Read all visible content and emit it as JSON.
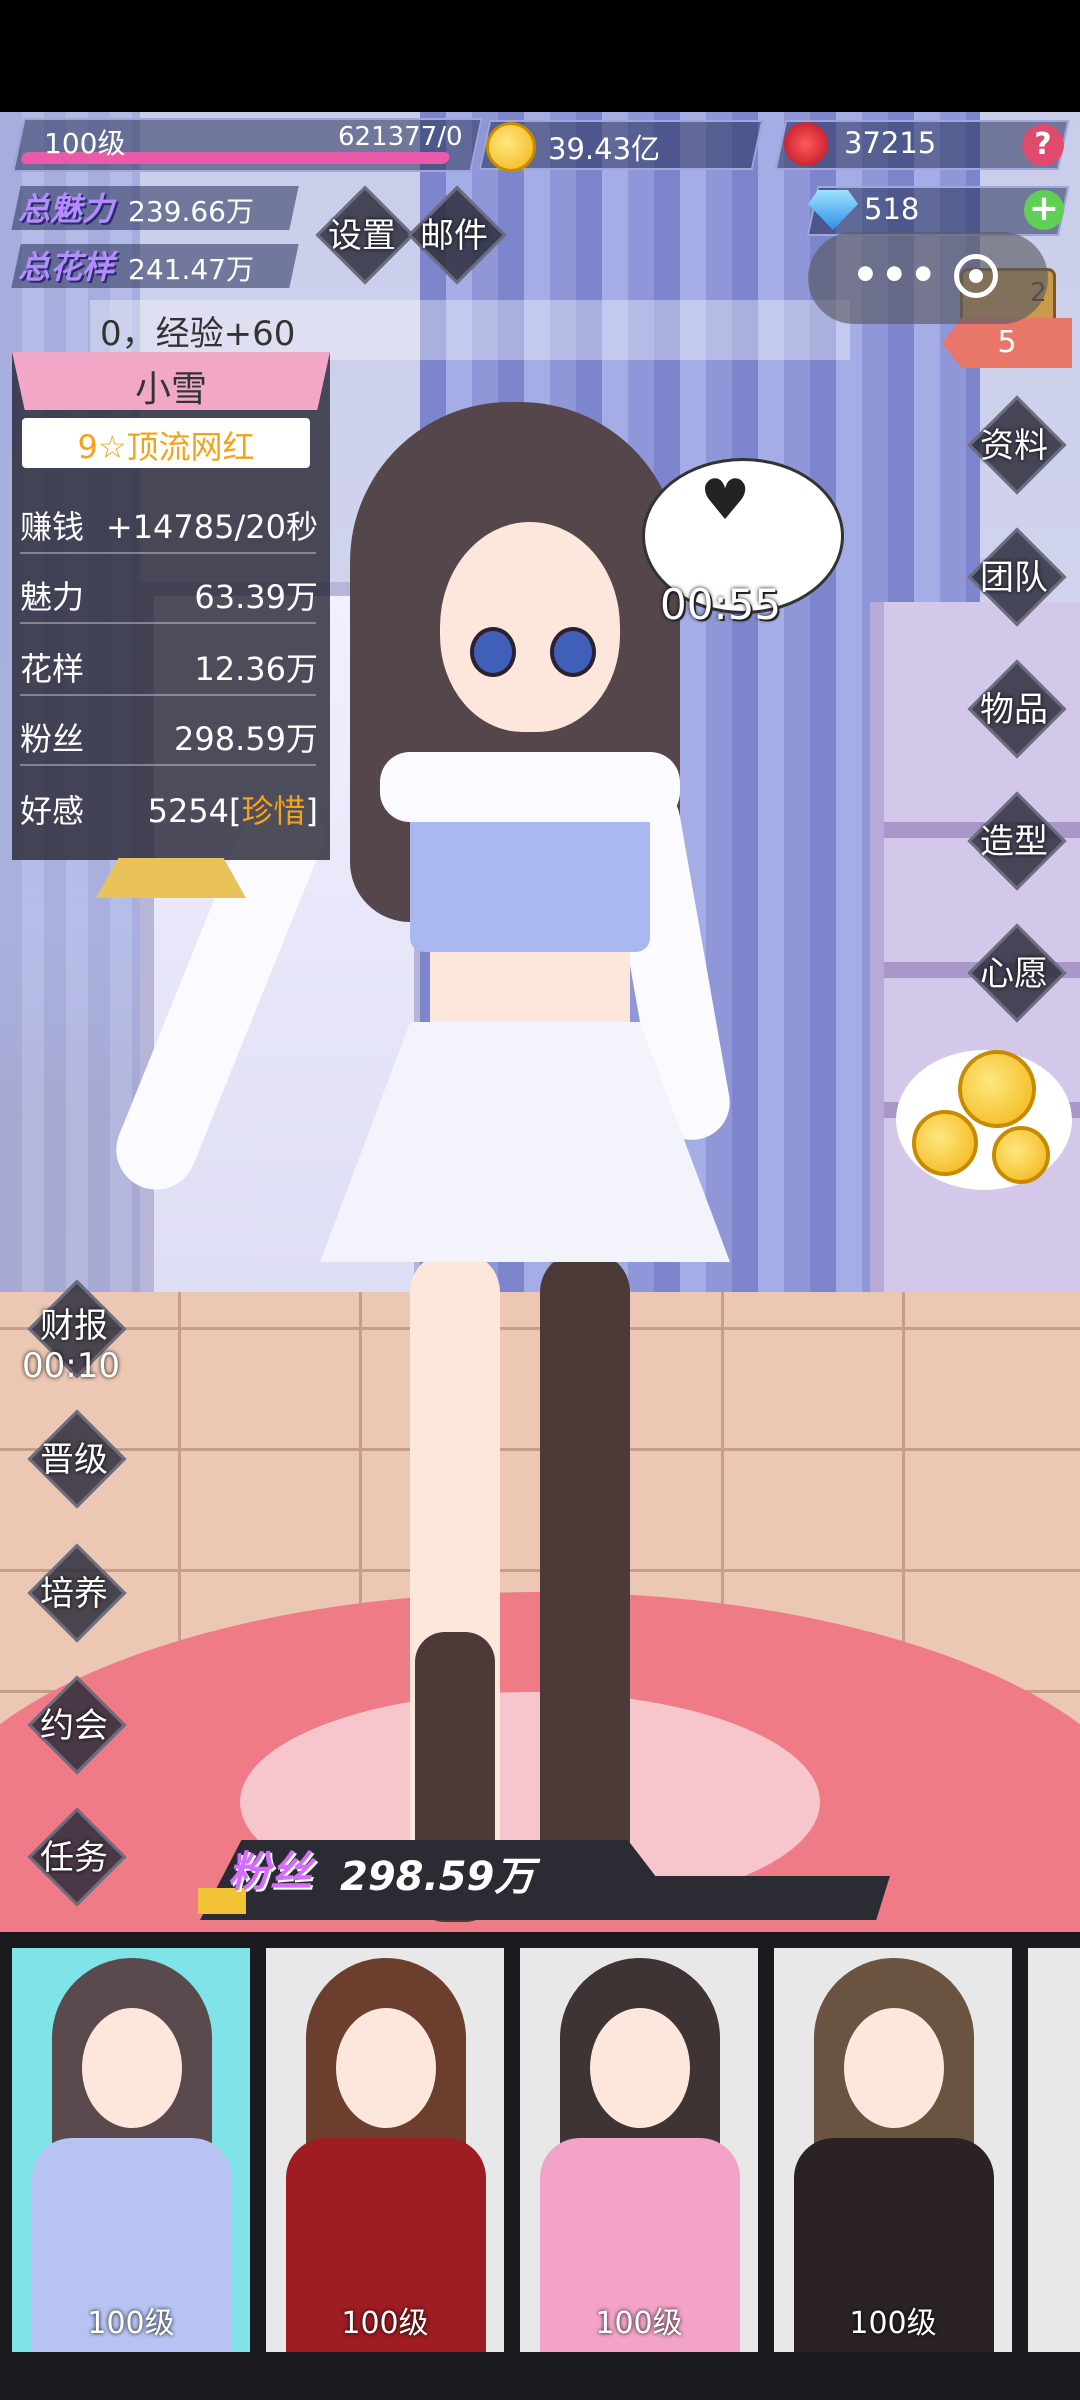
{
  "header": {
    "level": "100级",
    "exp": "621377/0",
    "exp_progress": 0.94,
    "gold": "39.43亿",
    "roses": "37215",
    "diamonds": "518",
    "help_symbol": "?",
    "add_symbol": "+"
  },
  "stats": {
    "charm_label": "总魅力",
    "charm_value": "239.66万",
    "style_label": "总花样",
    "style_value": "241.47万"
  },
  "top_buttons": {
    "settings": "设置",
    "mail": "邮件"
  },
  "marquee": "0，经验+60",
  "reward_count": "5",
  "chest_count": "2",
  "character": {
    "name": "小雪",
    "title": "9☆顶流网红",
    "rows": [
      {
        "label": "赚钱",
        "value": "+14785/20秒"
      },
      {
        "label": "魅力",
        "value": "63.39万"
      },
      {
        "label": "花样",
        "value": "12.36万"
      },
      {
        "label": "粉丝",
        "value": "298.59万"
      }
    ],
    "favor_label": "好感",
    "favor_value": "5254",
    "favor_bracket_open": "[",
    "favor_status": "珍惜",
    "favor_bracket_close": "]"
  },
  "bubble_timer": "00:55",
  "right_menu": [
    "资料",
    "团队",
    "物品",
    "造型",
    "心愿"
  ],
  "left_menu": {
    "report": "财报",
    "report_timer": "00:10",
    "items": [
      "晋级",
      "培养",
      "约会",
      "任务"
    ]
  },
  "fans": {
    "label": "粉丝",
    "value": "298.59万",
    "progress": 0.07
  },
  "roster": [
    {
      "level": "100级",
      "hair": "#5a4a4e",
      "outfit": "#b7c4f3",
      "bg": "#7fe3e8"
    },
    {
      "level": "100级",
      "hair": "#6b3e2e",
      "outfit": "#9e1c22",
      "bg": "#e8e8e8"
    },
    {
      "level": "100级",
      "hair": "#3e3434",
      "outfit": "#f4a3c8",
      "bg": "#e8e8e8"
    },
    {
      "level": "100级",
      "hair": "#6a5340",
      "outfit": "#2a2224",
      "bg": "#e8e8e8"
    }
  ]
}
